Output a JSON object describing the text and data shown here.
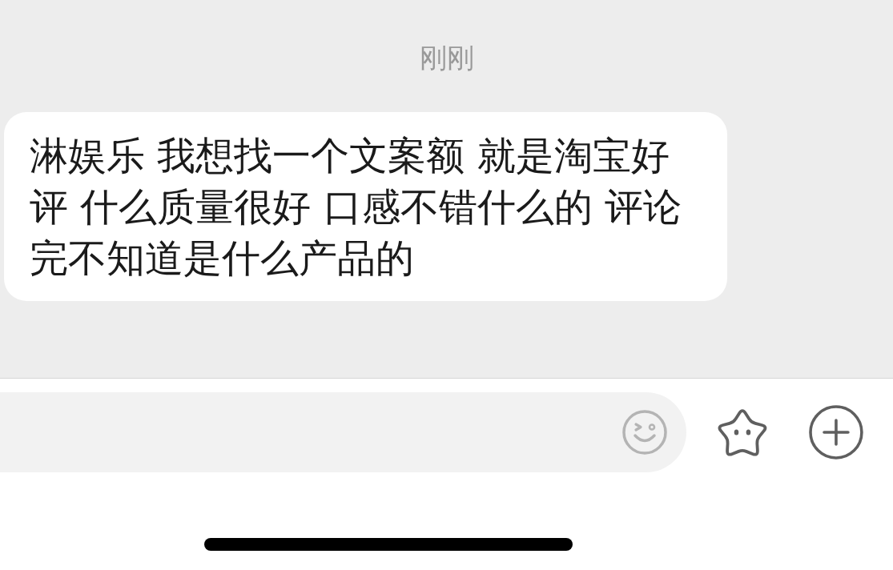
{
  "timestamp": "刚刚",
  "messages": [
    {
      "kind": "received",
      "text": "淋娱乐 我想找一个文案额 就是淘宝好评 什么质量很好 口感不错什么的 评论完不知道是什么产品的"
    }
  ]
}
